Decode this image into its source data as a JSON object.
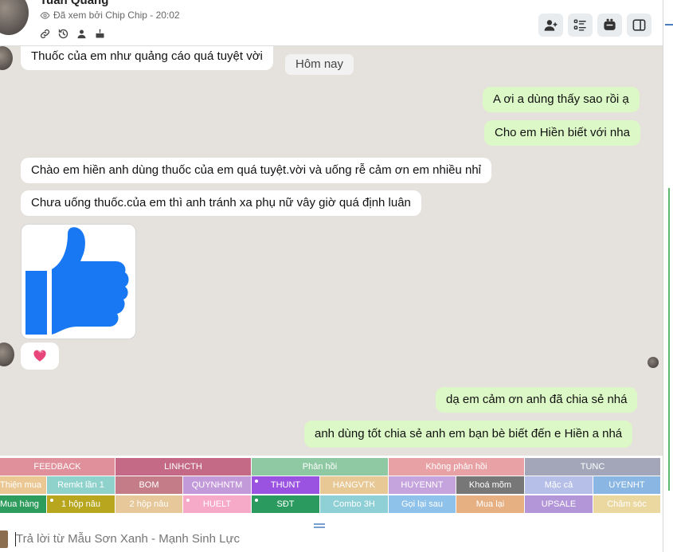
{
  "header": {
    "contact_name": "Tuấn Quang",
    "seen_status": "Đã xem bởi Chip Chip - 20:02"
  },
  "chat": {
    "date_pill": "Hôm nay",
    "messages": [
      {
        "dir": "in",
        "text": "Thuốc của em như quảng cáo quá tuyệt vời"
      },
      {
        "dir": "out",
        "text": "A ơi a dùng thấy sao rồi ạ"
      },
      {
        "dir": "out",
        "text": "Cho em Hiền biết với nha"
      },
      {
        "dir": "in",
        "text": "Chào em hiền anh dùng thuốc của em quá tuyệt.vời và uống rễ cảm ơn em nhiều nhỉ"
      },
      {
        "dir": "in",
        "text": "Chưa uống thuốc.của em thì anh tránh xa phụ nữ vây giờ quá định luân"
      },
      {
        "dir": "out",
        "text": "dạ em cảm ơn anh đã chia sẻ nhá"
      },
      {
        "dir": "out",
        "text": "anh dùng tốt chia sẻ anh em bạn bè biết đến e Hiền a nhá"
      }
    ]
  },
  "tags": {
    "row1": [
      {
        "label": "FEEDBACK",
        "color": "#e0909a"
      },
      {
        "label": "LINHCTH",
        "color": "#c46a86"
      },
      {
        "label": "Phản hồi",
        "color": "#8fc9a3"
      },
      {
        "label": "Không phản hồi",
        "color": "#e8a2a6"
      },
      {
        "label": "TUNC",
        "color": "#a3a6b8"
      }
    ],
    "row2": [
      {
        "label": "Thiện mua",
        "color": "#ebc893"
      },
      {
        "label": "Remkt lần 1",
        "color": "#8fd2cc"
      },
      {
        "label": "BOM",
        "color": "#c47c88"
      },
      {
        "label": "QUYNHNTM",
        "color": "#c39ad9"
      },
      {
        "label": "THUNT",
        "color": "#9a52e0"
      },
      {
        "label": "HANGVTK",
        "color": "#e8c895"
      },
      {
        "label": "HUYENNT",
        "color": "#c5a3dc"
      },
      {
        "label": "Khoá mõm",
        "color": "#777777"
      },
      {
        "label": "Mặc cả",
        "color": "#b5bfe8"
      },
      {
        "label": "UYENHT",
        "color": "#89b6e3"
      }
    ],
    "row3": [
      {
        "label": "Mua hàng",
        "color": "#2e9c5c"
      },
      {
        "label": "1 hộp nâu",
        "color": "#b8a61e"
      },
      {
        "label": "2 hộp nâu",
        "color": "#e6c89a"
      },
      {
        "label": "HUELT",
        "color": "#f6aac8"
      },
      {
        "label": "SĐT",
        "color": "#2a9a5e"
      },
      {
        "label": "Combo 3H",
        "color": "#8ed0d6"
      },
      {
        "label": "Gọi lại sau",
        "color": "#8ec2ea"
      },
      {
        "label": "Mua lại",
        "color": "#e6b082"
      },
      {
        "label": "UPSALE",
        "color": "#b296d8"
      },
      {
        "label": "Chăm sóc",
        "color": "#ebd7a0"
      }
    ]
  },
  "composer": {
    "placeholder": "Trả lời từ Mẫu Sơn Xanh - Mạnh Sinh Lực"
  },
  "icons": {
    "header_buttons": [
      "add-member-icon",
      "list-icon",
      "video-call-icon",
      "sidebar-toggle-icon"
    ],
    "mini": [
      "link-icon",
      "history-icon",
      "person-icon",
      "cake-icon"
    ]
  }
}
